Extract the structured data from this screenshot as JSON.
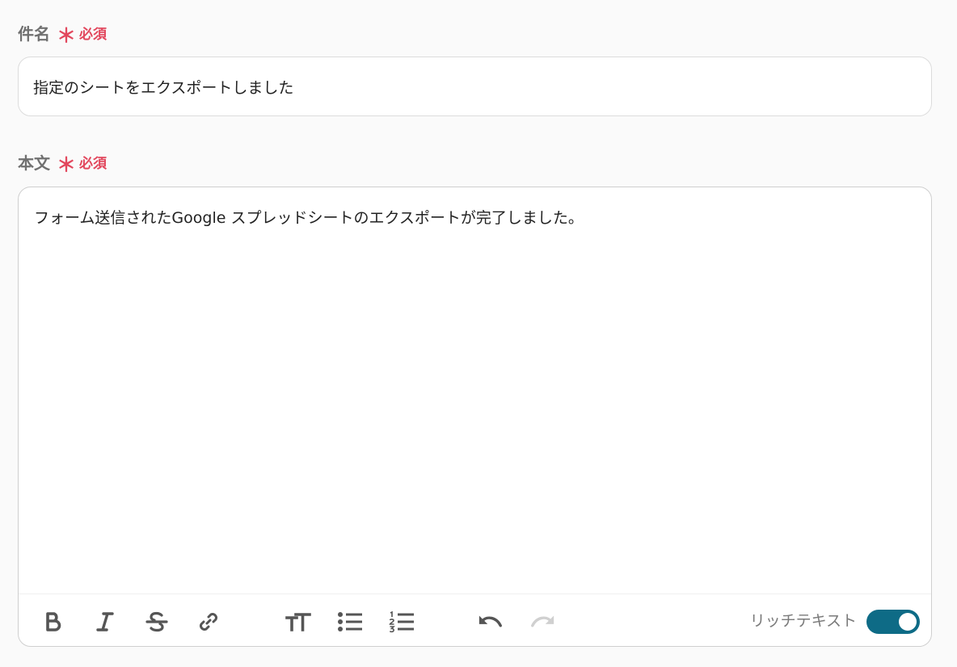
{
  "subject": {
    "label": "件名",
    "required_mark": "＊",
    "required_text": "必須",
    "value": "指定のシートをエクスポートしました"
  },
  "body": {
    "label": "本文",
    "required_mark": "＊",
    "required_text": "必須",
    "value": "フォーム送信されたGoogle スプレッドシートのエクスポートが完了しました。"
  },
  "toolbar": {
    "icons": [
      "bold-icon",
      "italic-icon",
      "strikethrough-icon",
      "link-icon",
      "text-size-icon",
      "bullet-list-icon",
      "numbered-list-icon",
      "undo-icon",
      "redo-icon"
    ],
    "rich_text_label": "リッチテキスト",
    "rich_text_enabled": true
  },
  "colors": {
    "required": "#e2475d",
    "toggle_on": "#0e6b86",
    "icon": "#555555",
    "icon_disabled": "#d0d0d0"
  }
}
